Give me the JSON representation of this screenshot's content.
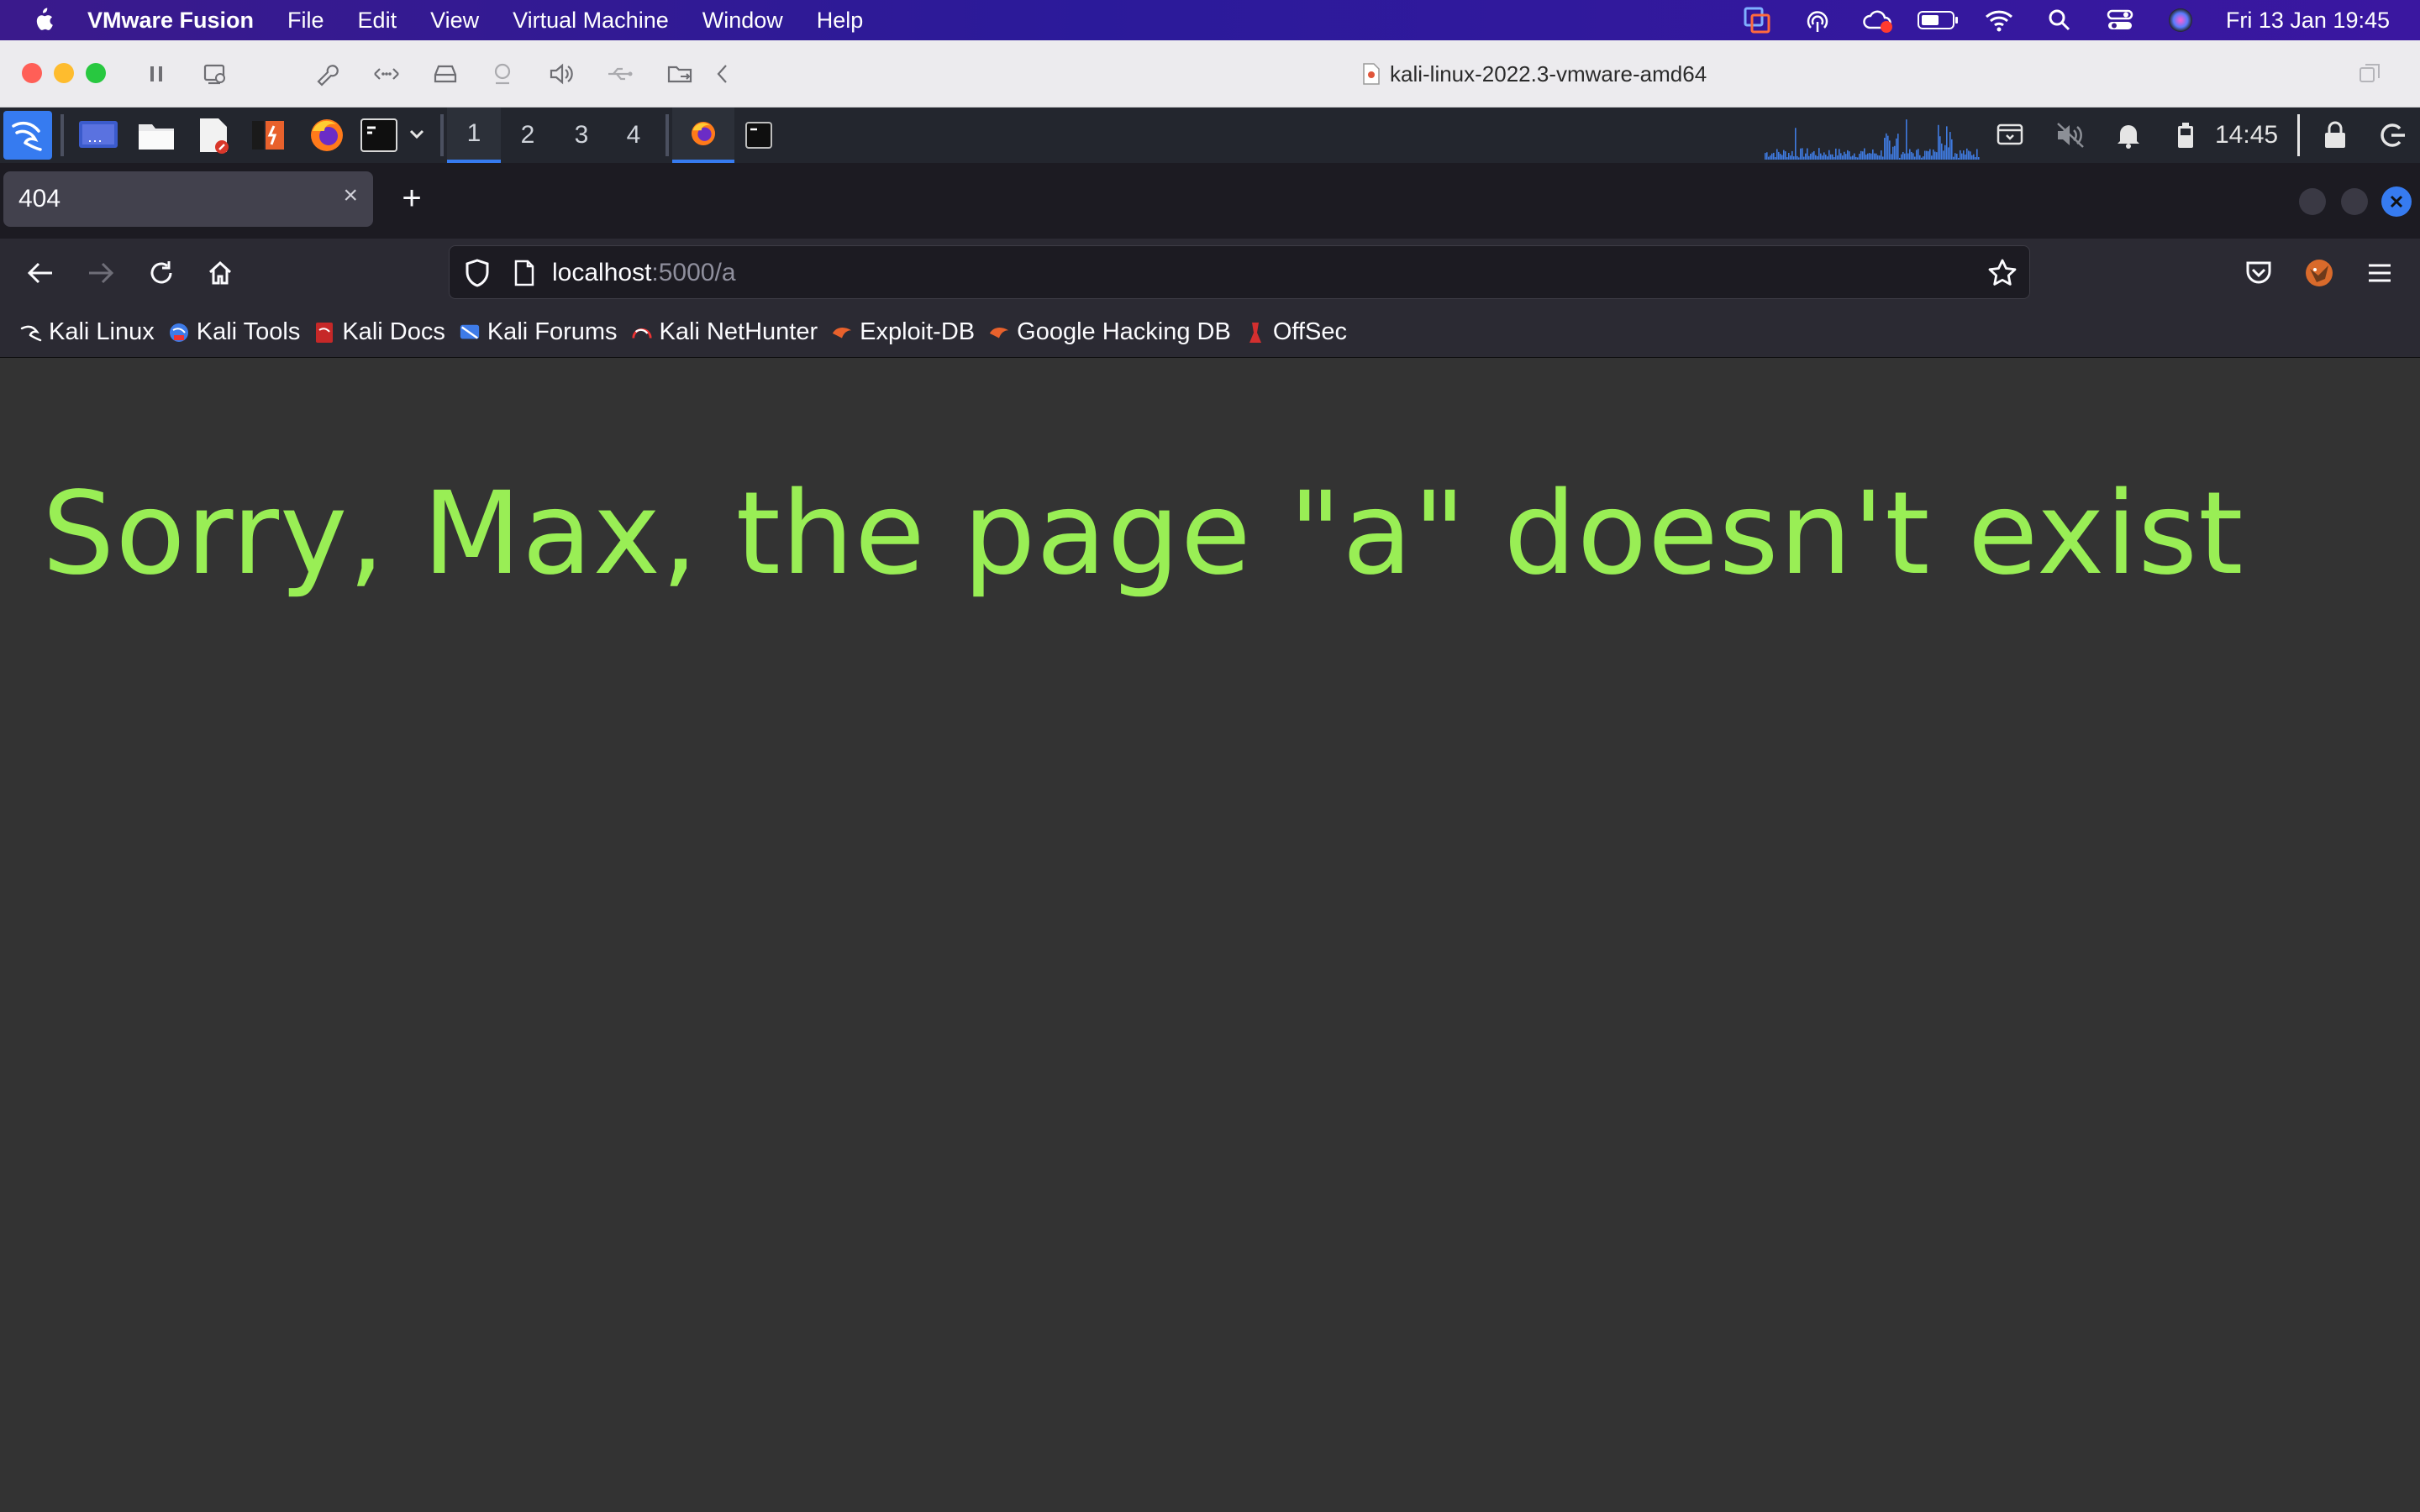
{
  "mac_menubar": {
    "app_name": "VMware Fusion",
    "menus": [
      "File",
      "Edit",
      "View",
      "Virtual Machine",
      "Window",
      "Help"
    ],
    "clock": "Fri 13 Jan  19:45",
    "status_icons": [
      "vmware-icon",
      "airdrop-icon",
      "creative-cloud-icon",
      "battery-icon",
      "wifi-icon",
      "search-icon",
      "control-center-icon",
      "siri-icon"
    ]
  },
  "vm_window": {
    "title": "kali-linux-2022.3-vmware-amd64"
  },
  "kali_panel": {
    "workspaces": [
      "1",
      "2",
      "3",
      "4"
    ],
    "active_workspace": "1",
    "time": "14:45",
    "accent": "#367bf0"
  },
  "browser": {
    "tab": {
      "title": "404",
      "close": "×"
    },
    "new_tab_label": "+",
    "url": {
      "host": "localhost",
      "rest": ":5000/a"
    },
    "bookmarks": [
      {
        "label": "Kali Linux",
        "icon": "kali-dragon-icon"
      },
      {
        "label": "Kali Tools",
        "icon": "kali-tools-icon"
      },
      {
        "label": "Kali Docs",
        "icon": "kali-docs-icon"
      },
      {
        "label": "Kali Forums",
        "icon": "kali-forums-icon"
      },
      {
        "label": "Kali NetHunter",
        "icon": "nethunter-icon"
      },
      {
        "label": "Exploit-DB",
        "icon": "exploit-db-icon"
      },
      {
        "label": "Google Hacking DB",
        "icon": "ghdb-icon"
      },
      {
        "label": "OffSec",
        "icon": "offsec-icon"
      }
    ]
  },
  "page": {
    "message": "Sorry, Max, the page \"a\" doesn't exist",
    "text_color": "#99ee55",
    "background": "#333333"
  }
}
